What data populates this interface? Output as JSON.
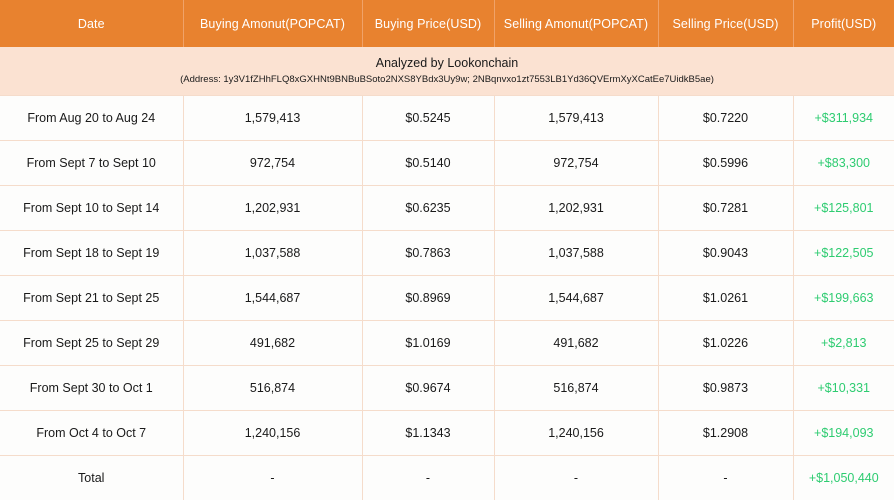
{
  "table": {
    "headers": [
      "Date",
      "Buying Amonut(POPCAT)",
      "Buying Price(USD)",
      "Selling Amonut(POPCAT)",
      "Selling Price(USD)",
      "Profit(USD)"
    ],
    "banner": {
      "title": "Analyzed by Lookonchain",
      "address": "(Address: 1y3V1fZHhFLQ8xGXHNt9BNBuBSoto2NXS8YBdx3Uy9w; 2NBqnvxo1zt7553LB1Yd36QVErmXyXCatEe7UidkB5ae)"
    },
    "rows": [
      {
        "date": "From Aug 20 to Aug 24",
        "buying_amount": "1,579,413",
        "buying_price": "$0.5245",
        "selling_amount": "1,579,413",
        "selling_price": "$0.7220",
        "profit": "+$311,934"
      },
      {
        "date": "From Sept 7 to Sept 10",
        "buying_amount": "972,754",
        "buying_price": "$0.5140",
        "selling_amount": "972,754",
        "selling_price": "$0.5996",
        "profit": "+$83,300"
      },
      {
        "date": "From Sept 10 to Sept 14",
        "buying_amount": "1,202,931",
        "buying_price": "$0.6235",
        "selling_amount": "1,202,931",
        "selling_price": "$0.7281",
        "profit": "+$125,801"
      },
      {
        "date": "From Sept 18 to Sept 19",
        "buying_amount": "1,037,588",
        "buying_price": "$0.7863",
        "selling_amount": "1,037,588",
        "selling_price": "$0.9043",
        "profit": "+$122,505"
      },
      {
        "date": "From Sept 21 to Sept 25",
        "buying_amount": "1,544,687",
        "buying_price": "$0.8969",
        "selling_amount": "1,544,687",
        "selling_price": "$1.0261",
        "profit": "+$199,663"
      },
      {
        "date": "From Sept 25 to Sept 29",
        "buying_amount": "491,682",
        "buying_price": "$1.0169",
        "selling_amount": "491,682",
        "selling_price": "$1.0226",
        "profit": "+$2,813"
      },
      {
        "date": "From Sept 30 to Oct 1",
        "buying_amount": "516,874",
        "buying_price": "$0.9674",
        "selling_amount": "516,874",
        "selling_price": "$0.9873",
        "profit": "+$10,331"
      },
      {
        "date": "From Oct 4 to Oct 7",
        "buying_amount": "1,240,156",
        "buying_price": "$1.1343",
        "selling_amount": "1,240,156",
        "selling_price": "$1.2908",
        "profit": "+$194,093"
      },
      {
        "date": "Total",
        "buying_amount": "-",
        "buying_price": "-",
        "selling_amount": "-",
        "selling_price": "-",
        "profit": "+$1,050,440"
      }
    ]
  },
  "colors": {
    "header_bg": "#e8822f",
    "banner_bg": "#fbe2d2",
    "border": "#f5dccb",
    "profit_green": "#2ecc71",
    "text": "#1a1a1a"
  }
}
